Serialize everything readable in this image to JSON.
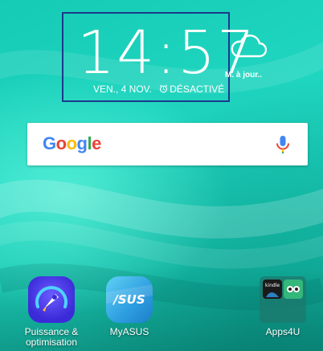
{
  "clock": {
    "time": "14:57",
    "date": "VEN., 4 NOV.",
    "alarm": "DÉSACTIVÉ"
  },
  "weather": {
    "text": "M. à jour..",
    "icon": "cloud-icon"
  },
  "search": {
    "logo_letters": [
      "G",
      "o",
      "o",
      "g",
      "l",
      "e"
    ],
    "icon": "mic-icon"
  },
  "colors": {
    "wallpaper": "#17c9b3",
    "google_blue": "#4285f4",
    "google_red": "#ea4335",
    "google_yellow": "#fbbc05",
    "google_green": "#34a853",
    "widget_border": "#1b3a8a"
  },
  "apps": [
    {
      "label": "Puissance & optimisation",
      "icon": "rocket-gauge-icon"
    },
    {
      "label": "MyASUS",
      "icon": "asus-logo-icon"
    },
    {
      "label": "Apps4U",
      "icon": "folder-icon",
      "contains": [
        "kindle",
        "tripadvisor"
      ]
    }
  ]
}
